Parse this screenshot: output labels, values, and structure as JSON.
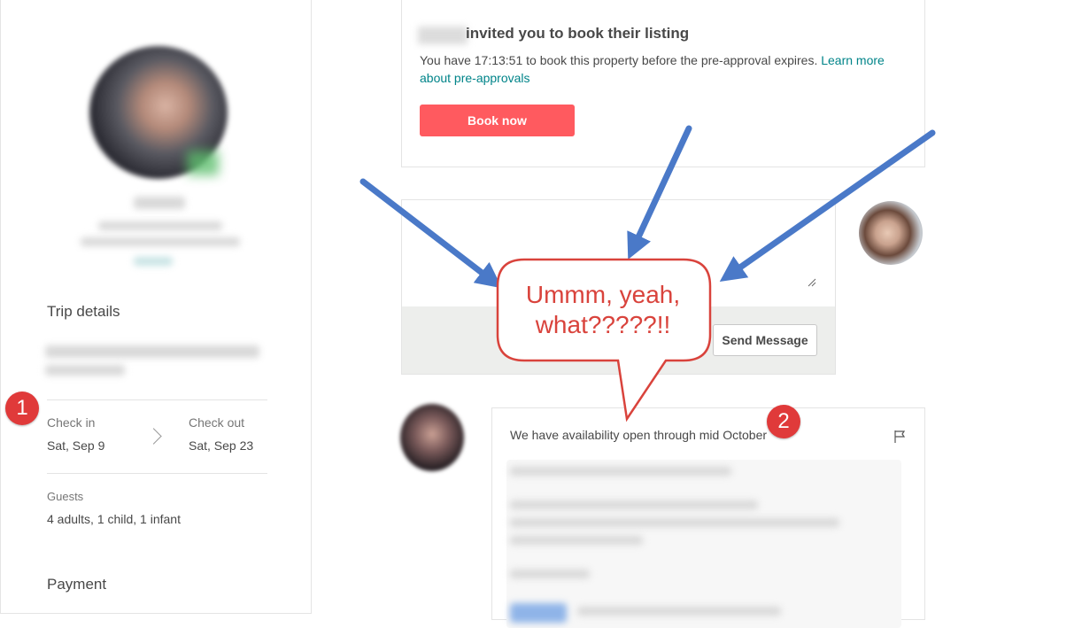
{
  "sidebar": {
    "trip_details_title": "Trip details",
    "check_in_label": "Check in",
    "check_in_value": "Sat, Sep 9",
    "check_out_label": "Check out",
    "check_out_value": "Sat, Sep 23",
    "guests_label": "Guests",
    "guests_value": "4 adults, 1 child, 1 infant",
    "payment_title": "Payment"
  },
  "invite_card": {
    "heading": "invited you to book their listing",
    "body_text": "You have 17:13:51 to book this property before the pre-approval expires.",
    "learn_more_link": "Learn more about pre-approvals",
    "book_button": "Book now"
  },
  "composer": {
    "send_button": "Send Message"
  },
  "host_message": {
    "text": "We have availability open through mid October"
  },
  "annotations": {
    "callout_line1": "Ummm, yeah,",
    "callout_line2": "what?????!!",
    "badge_1": "1",
    "badge_2": "2"
  },
  "colors": {
    "accent": "#ff5a5f",
    "link": "#008489",
    "annotation_red": "#d9433c",
    "arrow_blue": "#4a79c8"
  }
}
